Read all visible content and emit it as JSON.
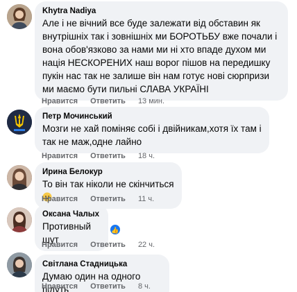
{
  "comments": [
    {
      "author": "Khytra Nadiya",
      "text": "Але і не вічний все буде залежати від обставин як внутрішніх так і зовнішніх ми БОРОТЬБУ вже почали і вона обов'язково за нами ми ні хто впаде духом ми нація НЕСКОРЕНИХ наш ворог пішов на передишку пукін нас так не залише він нам готує нові сюрпризи ми маємо бути пильні СЛАВА УКРАЇНІ",
      "like_label": "Нравится",
      "reply_label": "Ответить",
      "time": "13 мин.",
      "avatar_icon": "avatar-woman-photo-icon",
      "avatar_color": "#8a6f5a"
    },
    {
      "author": "Петр Мочинський",
      "text": "Мозги не хай поміняє собі і двійникам,хотя їх там і так не маж,одне лайно",
      "like_label": "Нравится",
      "reply_label": "Ответить",
      "time": "18 ч.",
      "avatar_icon": "trident-emblem-icon",
      "avatar_color": "#1f2a44"
    },
    {
      "author": "Ирина Белокур",
      "text": "То він так ніколи не скінчиться",
      "emoji_icon": "sad-face-emoji-icon",
      "like_label": "Нравится",
      "reply_label": "Ответить",
      "time": "11 ч.",
      "avatar_icon": "avatar-woman-photo-icon",
      "avatar_color": "#7a5b4c"
    },
    {
      "author": "Оксана Чалых",
      "text": "Противный шут",
      "reaction_icon": "like-thumb-icon",
      "like_label": "Нравится",
      "reply_label": "Ответить",
      "time": "22 ч.",
      "avatar_icon": "avatar-woman-photo-icon",
      "avatar_color": "#9a6e5f"
    },
    {
      "author": "Світлана Стадницька",
      "text": "Думаю один на одного підуть",
      "like_label": "Нравится",
      "reply_label": "Ответить",
      "time": "8 ч.",
      "avatar_icon": "avatar-woman-photo-icon",
      "avatar_color": "#5e6a73"
    }
  ],
  "colors": {
    "bubble": "#f0f2f5",
    "meta_text": "#65676b",
    "like_blue": "#1877f2"
  }
}
